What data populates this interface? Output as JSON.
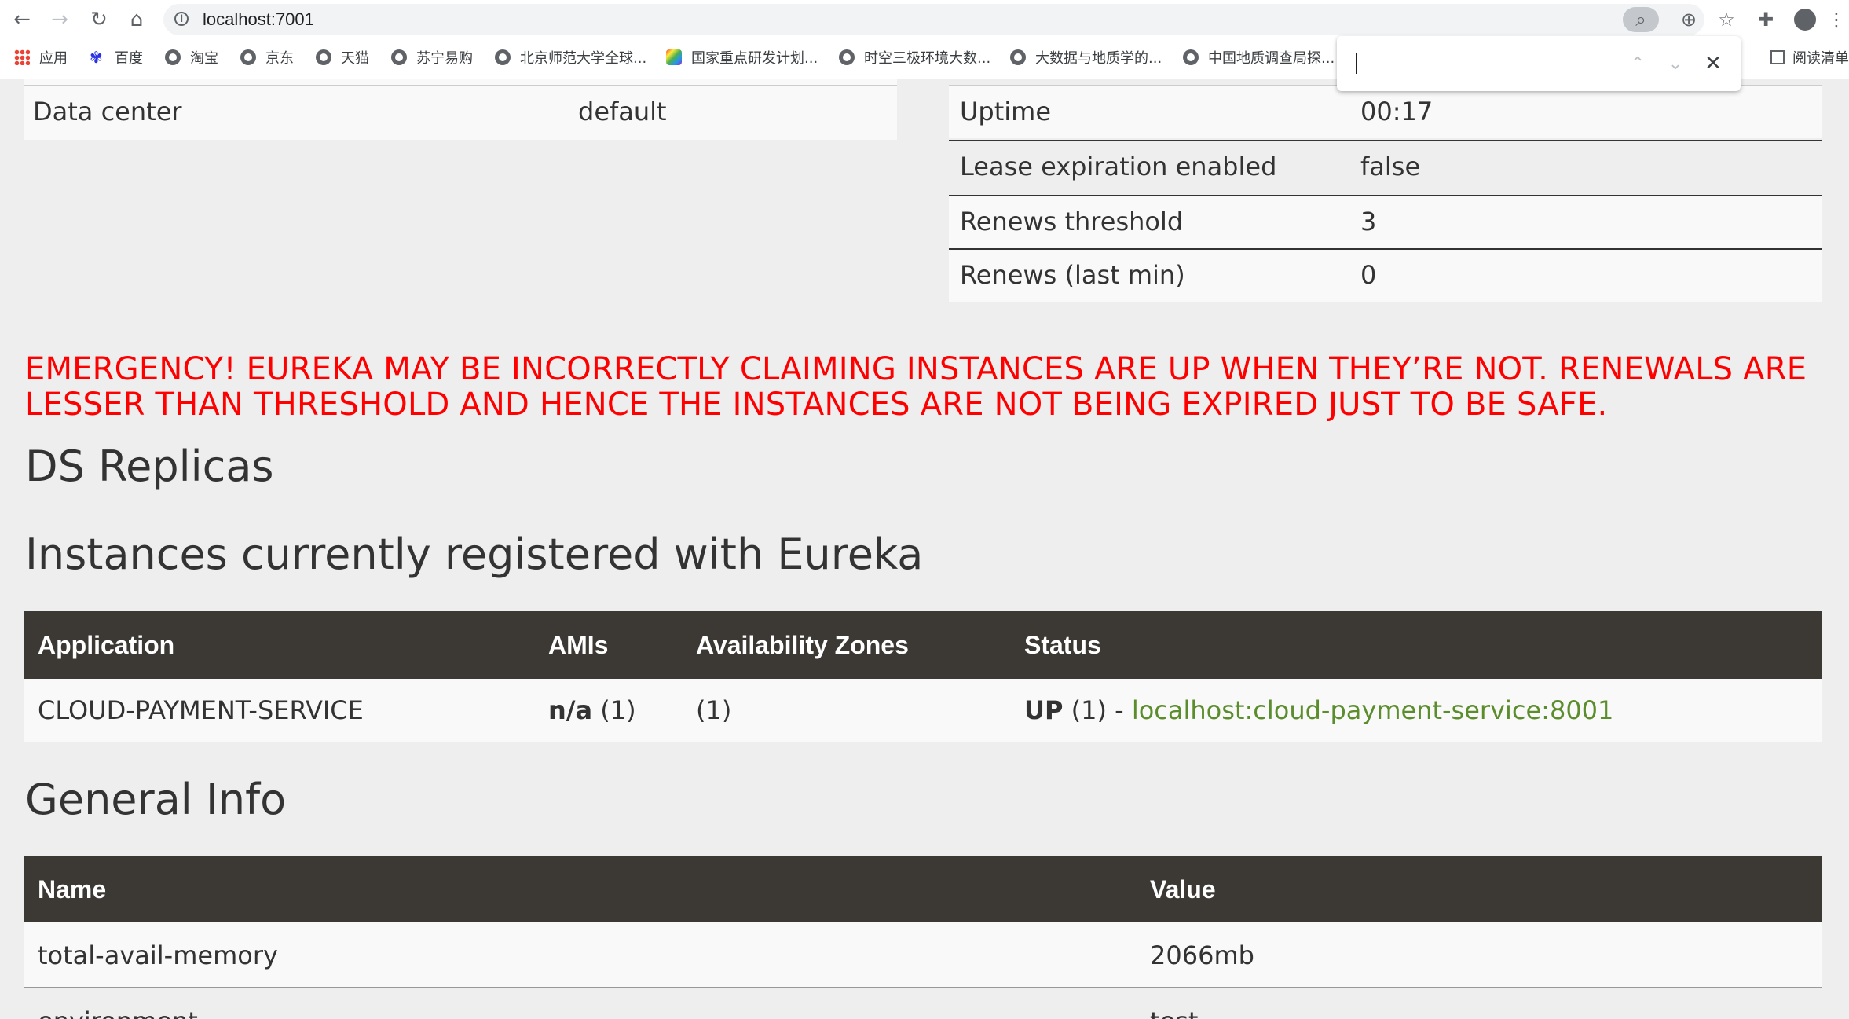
{
  "browser": {
    "url": "localhost:7001",
    "bookmarks": [
      "应用",
      "百度",
      "淘宝",
      "京东",
      "天猫",
      "苏宁易购",
      "北京师范大学全球...",
      "国家重点研发计划...",
      "时空三极环境大数...",
      "大数据与地质学的...",
      "中国地质调查局探..."
    ],
    "reader_mode": "阅读清单",
    "find_query": ""
  },
  "left_table": {
    "rows": [
      {
        "key": "Data center",
        "value": "default"
      }
    ]
  },
  "right_table": {
    "rows": [
      {
        "key": "Uptime",
        "value": "00:17"
      },
      {
        "key": "Lease expiration enabled",
        "value": "false"
      },
      {
        "key": "Renews threshold",
        "value": "3"
      },
      {
        "key": "Renews (last min)",
        "value": "0"
      }
    ]
  },
  "emergency_text": "EMERGENCY! EUREKA MAY BE INCORRECTLY CLAIMING INSTANCES ARE UP WHEN THEY’RE NOT. RENEWALS ARE LESSER THAN THRESHOLD AND HENCE THE INSTANCES ARE NOT BEING EXPIRED JUST TO BE SAFE.",
  "ds_replicas_title": "DS Replicas",
  "instances": {
    "title": "Instances currently registered with Eureka",
    "headers": [
      "Application",
      "AMIs",
      "Availability Zones",
      "Status"
    ],
    "rows": [
      {
        "application": "CLOUD-PAYMENT-SERVICE",
        "amis_bold": "n/a",
        "amis_count": "(1)",
        "zones": "(1)",
        "status_bold": "UP",
        "status_count": "(1) -",
        "status_link": "localhost:cloud-payment-service:8001"
      }
    ]
  },
  "general_info": {
    "title": "General Info",
    "headers": [
      "Name",
      "Value"
    ],
    "rows": [
      {
        "name": "total-avail-memory",
        "value": "2066mb"
      },
      {
        "name": "environment",
        "value": "test"
      }
    ]
  },
  "colors": {
    "emergency": "#ff0000",
    "table_header_bg": "#3c3834",
    "link": "#5c8d2d"
  }
}
